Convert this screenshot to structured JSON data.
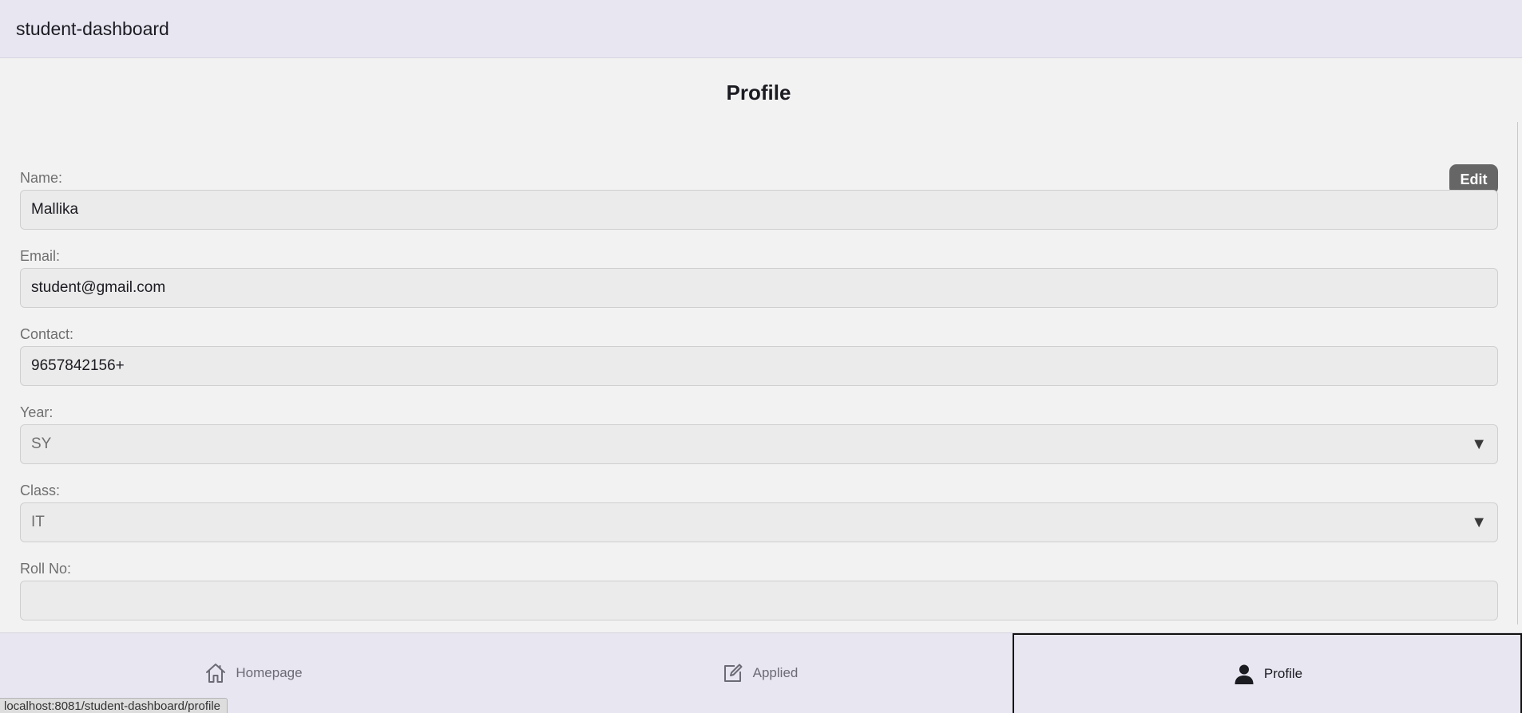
{
  "app": {
    "title": "student-dashboard"
  },
  "page": {
    "title": "Profile",
    "edit_label": "Edit"
  },
  "fields": {
    "name": {
      "label": "Name:",
      "value": "Mallika"
    },
    "email": {
      "label": "Email:",
      "value": "student@gmail.com"
    },
    "contact": {
      "label": "Contact:",
      "value": "9657842156+"
    },
    "year": {
      "label": "Year:",
      "value": "SY",
      "caret": "▼"
    },
    "class": {
      "label": "Class:",
      "value": "IT",
      "caret": "▼"
    },
    "roll": {
      "label": "Roll No:",
      "value": ""
    }
  },
  "nav": {
    "items": [
      {
        "label": "Homepage",
        "icon": "home-icon"
      },
      {
        "label": "Applied",
        "icon": "edit-square-icon"
      },
      {
        "label": "Profile",
        "icon": "person-icon",
        "active": true
      }
    ]
  },
  "status": {
    "url": "localhost:8081/student-dashboard/profile"
  }
}
